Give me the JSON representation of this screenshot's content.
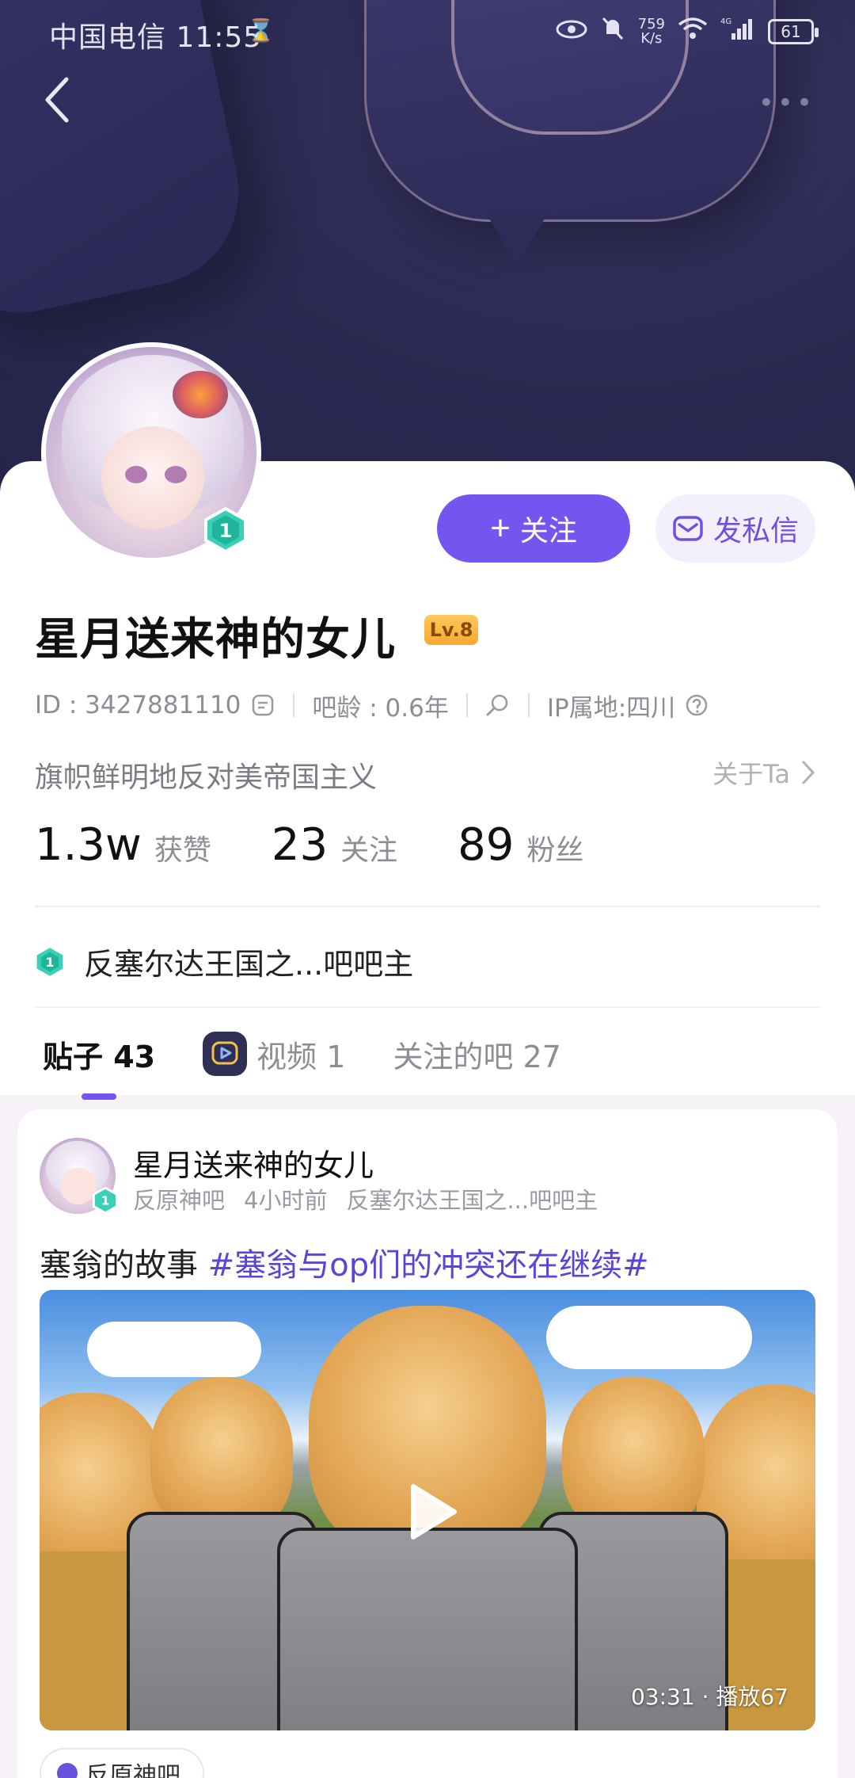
{
  "status_bar": {
    "carrier_time": "中国电信 11:55",
    "net_speed": "759",
    "net_unit": "K/s",
    "signal_label": "4G",
    "battery": "61"
  },
  "profile": {
    "name": "星月送来神的女儿",
    "level": "Lv.8",
    "follow_label": "关注",
    "message_label": "发私信",
    "id_text": "ID : 3427881110",
    "bar_age": "吧龄 : 0.6年",
    "ip_location": "IP属地:四川",
    "bio": "旗帜鲜明地反对美帝国主义",
    "about_label": "关于Ta",
    "stats": [
      {
        "num": "1.3w",
        "label": "获赞"
      },
      {
        "num": "23",
        "label": "关注"
      },
      {
        "num": "89",
        "label": "粉丝"
      }
    ],
    "honor": "反塞尔达王国之...吧吧主"
  },
  "tabs": [
    {
      "label": "贴子 43"
    },
    {
      "label": "视频 1"
    },
    {
      "label": "关注的吧 27"
    }
  ],
  "post": {
    "author": "星月送来神的女儿",
    "forum": "反原神吧",
    "time": "4小时前",
    "role": "反塞尔达王国之...吧吧主",
    "text_plain": "塞翁的故事 ",
    "hashtag": "#塞翁与op们的冲突还在继续#",
    "video_meta": "03:31 · 播放67",
    "forum_chip": "反原神吧"
  },
  "colors": {
    "accent": "#7555f0",
    "banner": "#2b2a52",
    "level_badge": "#f7a830",
    "hashtag": "#5b45d6"
  }
}
